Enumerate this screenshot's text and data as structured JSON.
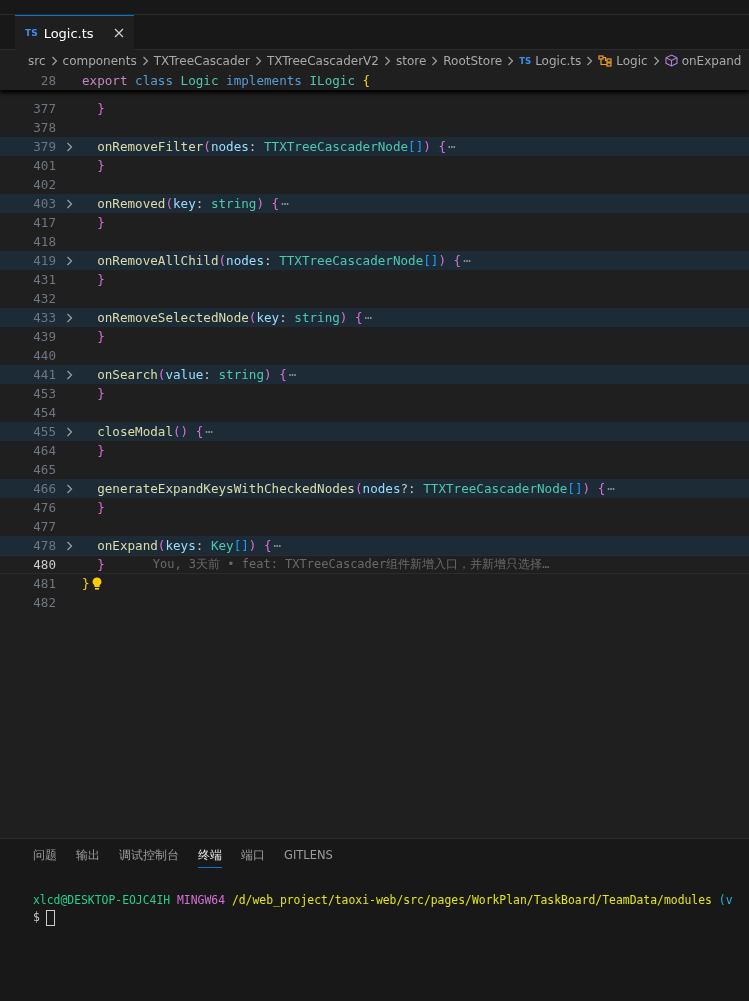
{
  "tabs": [
    {
      "badge": "TS",
      "label": "Logic.ts",
      "selected": true
    }
  ],
  "breadcrumbs": [
    {
      "label": "src",
      "kind": "folder"
    },
    {
      "label": "components",
      "kind": "folder"
    },
    {
      "label": "TXTreeCascader",
      "kind": "folder"
    },
    {
      "label": "TXTreeCascaderV2",
      "kind": "folder"
    },
    {
      "label": "store",
      "kind": "folder"
    },
    {
      "label": "RootStore",
      "kind": "folder"
    },
    {
      "label": "Logic.ts",
      "kind": "file",
      "badge": "TS"
    },
    {
      "label": "Logic",
      "kind": "class"
    },
    {
      "label": "onExpand",
      "kind": "method"
    }
  ],
  "sticky_line": {
    "number": "28",
    "tokens": [
      {
        "text": "export",
        "kind": "control"
      },
      {
        "text": " class",
        "kind": "keyword"
      },
      {
        "text": " Logic",
        "kind": "class"
      },
      {
        "text": " implements",
        "kind": "keyword"
      },
      {
        "text": " ILogic",
        "kind": "class"
      },
      {
        "text": " {",
        "kind": "b1"
      }
    ]
  },
  "lines": [
    {
      "number": "377",
      "folded": false,
      "current": false,
      "lightbulb": false,
      "tokens": [
        {
          "text": "  }",
          "kind": "b2"
        }
      ]
    },
    {
      "number": "378",
      "folded": false,
      "current": false,
      "lightbulb": false
    },
    {
      "number": "379",
      "folded": true,
      "current": false,
      "lightbulb": false,
      "tokens": [
        {
          "text": "  onRemoveFilter",
          "kind": "fn"
        },
        {
          "text": "(",
          "kind": "b2"
        },
        {
          "text": "nodes",
          "kind": "param"
        },
        {
          "text": ": ",
          "kind": "punct"
        },
        {
          "text": "TTXTreeCascaderNode",
          "kind": "type"
        },
        {
          "text": "[]",
          "kind": "b3"
        },
        {
          "text": ") {",
          "kind": "b2"
        },
        {
          "text": "⋯",
          "kind": "ellipsis"
        }
      ]
    },
    {
      "number": "401",
      "folded": false,
      "current": false,
      "lightbulb": false,
      "tokens": [
        {
          "text": "  }",
          "kind": "b2"
        }
      ]
    },
    {
      "number": "402",
      "folded": false,
      "current": false,
      "lightbulb": false
    },
    {
      "number": "403",
      "folded": true,
      "current": false,
      "lightbulb": false,
      "tokens": [
        {
          "text": "  onRemoved",
          "kind": "fn"
        },
        {
          "text": "(",
          "kind": "b2"
        },
        {
          "text": "key",
          "kind": "param"
        },
        {
          "text": ": ",
          "kind": "punct"
        },
        {
          "text": "string",
          "kind": "type"
        },
        {
          "text": ") {",
          "kind": "b2"
        },
        {
          "text": "⋯",
          "kind": "ellipsis"
        }
      ]
    },
    {
      "number": "417",
      "folded": false,
      "current": false,
      "lightbulb": false,
      "tokens": [
        {
          "text": "  }",
          "kind": "b2"
        }
      ]
    },
    {
      "number": "418",
      "folded": false,
      "current": false,
      "lightbulb": false
    },
    {
      "number": "419",
      "folded": true,
      "current": false,
      "lightbulb": false,
      "tokens": [
        {
          "text": "  onRemoveAllChild",
          "kind": "fn"
        },
        {
          "text": "(",
          "kind": "b2"
        },
        {
          "text": "nodes",
          "kind": "param"
        },
        {
          "text": ": ",
          "kind": "punct"
        },
        {
          "text": "TTXTreeCascaderNode",
          "kind": "type"
        },
        {
          "text": "[]",
          "kind": "b3"
        },
        {
          "text": ") {",
          "kind": "b2"
        },
        {
          "text": "⋯",
          "kind": "ellipsis"
        }
      ]
    },
    {
      "number": "431",
      "folded": false,
      "current": false,
      "lightbulb": false,
      "tokens": [
        {
          "text": "  }",
          "kind": "b2"
        }
      ]
    },
    {
      "number": "432",
      "folded": false,
      "current": false,
      "lightbulb": false
    },
    {
      "number": "433",
      "folded": true,
      "current": false,
      "lightbulb": false,
      "tokens": [
        {
          "text": "  onRemoveSelectedNode",
          "kind": "fn"
        },
        {
          "text": "(",
          "kind": "b2"
        },
        {
          "text": "key",
          "kind": "param"
        },
        {
          "text": ": ",
          "kind": "punct"
        },
        {
          "text": "string",
          "kind": "type"
        },
        {
          "text": ") {",
          "kind": "b2"
        },
        {
          "text": "⋯",
          "kind": "ellipsis"
        }
      ]
    },
    {
      "number": "439",
      "folded": false,
      "current": false,
      "lightbulb": false,
      "tokens": [
        {
          "text": "  }",
          "kind": "b2"
        }
      ]
    },
    {
      "number": "440",
      "folded": false,
      "current": false,
      "lightbulb": false
    },
    {
      "number": "441",
      "folded": true,
      "current": false,
      "lightbulb": false,
      "tokens": [
        {
          "text": "  onSearch",
          "kind": "fn"
        },
        {
          "text": "(",
          "kind": "b2"
        },
        {
          "text": "value",
          "kind": "param"
        },
        {
          "text": ": ",
          "kind": "punct"
        },
        {
          "text": "string",
          "kind": "type"
        },
        {
          "text": ") {",
          "kind": "b2"
        },
        {
          "text": "⋯",
          "kind": "ellipsis"
        }
      ]
    },
    {
      "number": "453",
      "folded": false,
      "current": false,
      "lightbulb": false,
      "tokens": [
        {
          "text": "  }",
          "kind": "b2"
        }
      ]
    },
    {
      "number": "454",
      "folded": false,
      "current": false,
      "lightbulb": false
    },
    {
      "number": "455",
      "folded": true,
      "current": false,
      "lightbulb": false,
      "tokens": [
        {
          "text": "  closeModal",
          "kind": "fn"
        },
        {
          "text": "() {",
          "kind": "b2"
        },
        {
          "text": "⋯",
          "kind": "ellipsis"
        }
      ]
    },
    {
      "number": "464",
      "folded": false,
      "current": false,
      "lightbulb": false,
      "tokens": [
        {
          "text": "  }",
          "kind": "b2"
        }
      ]
    },
    {
      "number": "465",
      "folded": false,
      "current": false,
      "lightbulb": false
    },
    {
      "number": "466",
      "folded": true,
      "current": false,
      "lightbulb": false,
      "tokens": [
        {
          "text": "  generateExpandKeysWithCheckedNodes",
          "kind": "fn"
        },
        {
          "text": "(",
          "kind": "b2"
        },
        {
          "text": "nodes",
          "kind": "param"
        },
        {
          "text": "?: ",
          "kind": "punct"
        },
        {
          "text": "TTXTreeCascaderNode",
          "kind": "type"
        },
        {
          "text": "[]",
          "kind": "b3"
        },
        {
          "text": ") {",
          "kind": "b2"
        },
        {
          "text": "⋯",
          "kind": "ellipsis"
        }
      ]
    },
    {
      "number": "476",
      "folded": false,
      "current": false,
      "lightbulb": false,
      "tokens": [
        {
          "text": "  }",
          "kind": "b2"
        }
      ]
    },
    {
      "number": "477",
      "folded": false,
      "current": false,
      "lightbulb": false
    },
    {
      "number": "478",
      "folded": true,
      "current": false,
      "lightbulb": false,
      "tokens": [
        {
          "text": "  onExpand",
          "kind": "fn"
        },
        {
          "text": "(",
          "kind": "b2"
        },
        {
          "text": "keys",
          "kind": "param"
        },
        {
          "text": ": ",
          "kind": "punct"
        },
        {
          "text": "Key",
          "kind": "type"
        },
        {
          "text": "[]",
          "kind": "b3"
        },
        {
          "text": ") {",
          "kind": "b2"
        },
        {
          "text": "⋯",
          "kind": "ellipsis"
        }
      ]
    },
    {
      "number": "480",
      "folded": false,
      "current": true,
      "lightbulb": false,
      "tokens": [
        {
          "text": "  }",
          "kind": "b2"
        }
      ],
      "blame": "You, 3天前 • feat: TXTreeCascader组件新增入口，并新增只选择…"
    },
    {
      "number": "481",
      "folded": false,
      "current": false,
      "lightbulb": true,
      "tokens": [
        {
          "text": "}",
          "kind": "b1"
        }
      ]
    },
    {
      "number": "482",
      "folded": false,
      "current": false,
      "lightbulb": false
    }
  ],
  "panel": {
    "tabs": [
      {
        "label": "问题",
        "selected": false
      },
      {
        "label": "输出",
        "selected": false
      },
      {
        "label": "调试控制台",
        "selected": false
      },
      {
        "label": "终端",
        "selected": true
      },
      {
        "label": "端口",
        "selected": false
      },
      {
        "label": "GITLENS",
        "selected": false
      }
    ],
    "terminal": [
      {
        "cursor": false,
        "segments": [
          {
            "text": "xlcd@DESKTOP-EOJC4IH",
            "kind": "user"
          },
          {
            "text": " MINGW64",
            "kind": "host"
          },
          {
            "text": " /d/web_project/taoxi-web/src/pages/WorkPlan/TaskBoard/TeamData/modules",
            "kind": "path"
          },
          {
            "text": " (v",
            "kind": "branch"
          }
        ]
      },
      {
        "cursor": true,
        "segments": [
          {
            "text": "$",
            "kind": "prompt"
          }
        ]
      }
    ]
  }
}
